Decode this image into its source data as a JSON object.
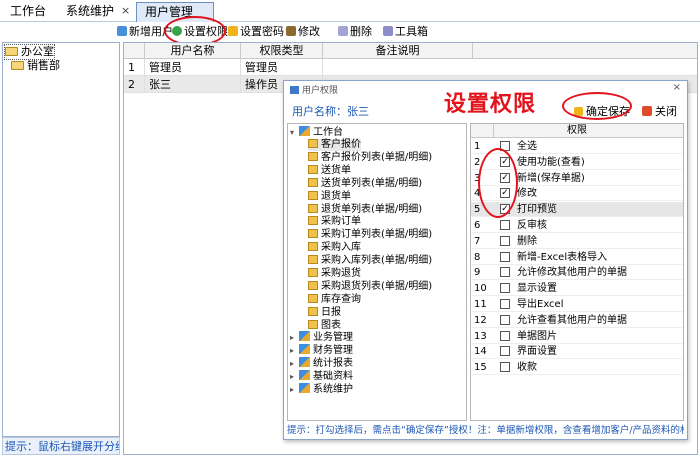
{
  "tabs": [
    {
      "label": "工作台"
    },
    {
      "label": "系统维护"
    },
    {
      "label": "用户管理"
    }
  ],
  "tab_close": "×",
  "toolbar": {
    "add": "新增用户",
    "set_perm": "设置权限",
    "set_pwd": "设置密码",
    "edit": "修改",
    "delete": "删除",
    "toolbox": "工具箱"
  },
  "left_tree": {
    "items": [
      "办公室",
      "销售部"
    ]
  },
  "left_hint": "提示：鼠标右键展开分组选项",
  "grid": {
    "headers": [
      "用户名称",
      "权限类型",
      "备注说明"
    ],
    "rows": [
      {
        "num": "1",
        "name": "管理员",
        "type": "管理员"
      },
      {
        "num": "2",
        "name": "张三",
        "type": "操作员"
      }
    ]
  },
  "dialog": {
    "title": "用户权限",
    "close_x": "×",
    "user_label": "用户名称：张三",
    "annotation": "设置权限",
    "save": "确定保存",
    "close": "关闭",
    "tree": {
      "root": "工作台",
      "children": [
        "客户报价",
        "客户报价列表(单据/明细)",
        "送货单",
        "送货单列表(单据/明细)",
        "退货单",
        "退货单列表(单据/明细)",
        "采购订单",
        "采购订单列表(单据/明细)",
        "采购入库",
        "采购入库列表(单据/明细)",
        "采购退货",
        "采购退货列表(单据/明细)",
        "库存查询",
        "日报",
        "图表"
      ],
      "groups": [
        "业务管理",
        "财务管理",
        "统计报表",
        "基础资料",
        "系统维护"
      ]
    },
    "perm_header": "权限",
    "perms": [
      {
        "num": "1",
        "label": "全选",
        "checked": false
      },
      {
        "num": "2",
        "label": "使用功能(查看)",
        "checked": true
      },
      {
        "num": "3",
        "label": "新增(保存单据)",
        "checked": true
      },
      {
        "num": "4",
        "label": "修改",
        "checked": true
      },
      {
        "num": "5",
        "label": "打印预览",
        "checked": true
      },
      {
        "num": "6",
        "label": "反审核",
        "checked": false
      },
      {
        "num": "7",
        "label": "删除",
        "checked": false
      },
      {
        "num": "8",
        "label": "新增-Excel表格导入",
        "checked": false
      },
      {
        "num": "9",
        "label": "允许修改其他用户的单据",
        "checked": false
      },
      {
        "num": "10",
        "label": "显示设置",
        "checked": false
      },
      {
        "num": "11",
        "label": "导出Excel",
        "checked": false
      },
      {
        "num": "12",
        "label": "允许查看其他用户的单据",
        "checked": false
      },
      {
        "num": "13",
        "label": "单据图片",
        "checked": false
      },
      {
        "num": "14",
        "label": "界面设置",
        "checked": false
      },
      {
        "num": "15",
        "label": "收款",
        "checked": false
      }
    ],
    "hint": "提示：打勾选择后，需点击“确定保存”授权！注：单据新增权限，含查看增加客户/产品资料的权限。"
  },
  "colors": {
    "accent": "#1c58b4",
    "annotation": "#e3131c"
  }
}
